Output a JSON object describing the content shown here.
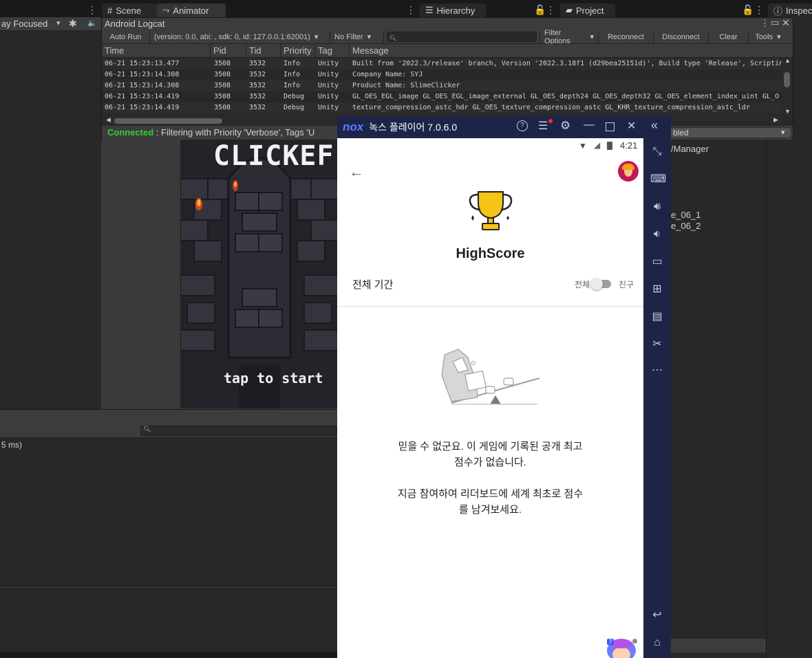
{
  "unity": {
    "tabs": {
      "scene": "Scene",
      "animator": "Animator",
      "hierarchy": "Hierarchy",
      "project": "Project",
      "inspector": "Inspect"
    },
    "game_toolbar": {
      "play_focused": "ay Focused"
    },
    "console": {
      "timing": "5 ms)"
    },
    "hierarchy_items": [
      "/Manager",
      "e_06_1",
      "e_06_2"
    ],
    "dropdown_right_label": "bled",
    "game_text": {
      "title": "CLICKEF",
      "tap": "tap to start"
    }
  },
  "logcat": {
    "title": "Android Logcat",
    "toolbar": {
      "auto_run": "Auto Run",
      "device": "(version: 0.0, abi: , sdk: 0, id: 127.0.0.1:62001)",
      "filter": "No Filter",
      "filter_options": "Filter Options",
      "reconnect": "Reconnect",
      "disconnect": "Disconnect",
      "clear": "Clear",
      "tools": "Tools"
    },
    "columns": [
      "Time",
      "Pid",
      "Tid",
      "Priority",
      "Tag",
      "Message"
    ],
    "rows": [
      [
        "06-21 15:23:13.477",
        "3508",
        "3532",
        "Info",
        "Unity",
        "Built from '2022.3/release' branch, Version '2022.3.18f1 (d29bea25151d)', Build type 'Release', Scriptin"
      ],
      [
        "06-21 15:23:14.308",
        "3508",
        "3532",
        "Info",
        "Unity",
        "Company Name: SYJ"
      ],
      [
        "06-21 15:23:14.308",
        "3508",
        "3532",
        "Info",
        "Unity",
        "Product Name: SlimeClicker"
      ],
      [
        "06-21 15:23:14.419",
        "3508",
        "3532",
        "Debug",
        "Unity",
        " GL_OES_EGL_image GL_OES_EGL_image_external GL_OES_depth24 GL_OES_depth32 GL_OES_element_index_uint GL_O"
      ],
      [
        "06-21 15:23:14.419",
        "3508",
        "3532",
        "Debug",
        "Unity",
        "texture_compression_astc_hdr GL_OES_texture_compression_astc GL_KHR_texture_compression_astc_ldr"
      ]
    ],
    "status_connected": "Connected",
    "status_rest": " : Filtering with Priority 'Verbose', Tags 'U"
  },
  "nox": {
    "logo": "nox",
    "title": "녹스 플레이어 7.0.6.0"
  },
  "android": {
    "status_time": "4:21",
    "app_title": "HighScore",
    "period": "전체 기간",
    "toggle_left": "전체",
    "toggle_right": "친구",
    "empty_line1": "믿을 수 없군요. 이 게임에 기록된 공개 최고",
    "empty_line2": "점수가 없습니다.",
    "empty_line3": "지금 참여하여 리더보드에 세계 최초로 점수",
    "empty_line4": "를 남겨보세요.",
    "badge": "7"
  },
  "colors": {
    "nox_navy": "#1d2448",
    "connected_green": "#2fd12f",
    "trophy_gold": "#f6c416"
  }
}
